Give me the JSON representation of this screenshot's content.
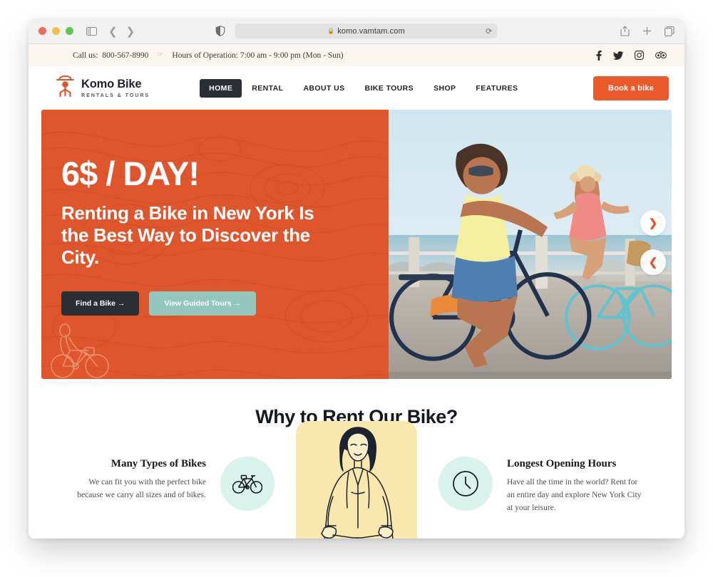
{
  "browser": {
    "url": "komo.vamtam.com",
    "lock_icon": "lock-icon",
    "reload_icon": "reload-icon",
    "back_icon": "chevron-left-icon",
    "forward_icon": "chevron-right-icon",
    "sidebar_icon": "sidebar-toggle-icon",
    "shield_icon": "privacy-shield-icon",
    "share_icon": "share-icon",
    "newtab_icon": "plus-icon",
    "tabs_icon": "tab-overview-icon"
  },
  "topbar": {
    "call_label": "Call us:",
    "phone": "800-567-8990",
    "separator_icon": "pointing-hand-icon",
    "hours": "Hours of Operation: 7:00 am - 9:00 pm (Mon - Sun)",
    "social": [
      {
        "name": "facebook-icon",
        "label": "f"
      },
      {
        "name": "twitter-icon",
        "label": ""
      },
      {
        "name": "instagram-icon",
        "label": ""
      },
      {
        "name": "tripadvisor-icon",
        "label": ""
      }
    ]
  },
  "header": {
    "logo_icon": "komo-bike-logo-icon",
    "logo_title": "Komo Bike",
    "logo_subtitle": "RENTALS & TOURS",
    "nav": [
      {
        "label": "HOME",
        "active": true
      },
      {
        "label": "RENTAL",
        "active": false
      },
      {
        "label": "ABOUT US",
        "active": false
      },
      {
        "label": "BIKE TOURS",
        "active": false
      },
      {
        "label": "SHOP",
        "active": false
      },
      {
        "label": "FEATURES",
        "active": false
      }
    ],
    "cta_label": "Book a bike"
  },
  "hero": {
    "price": "6$ / DAY!",
    "headline": "Renting a Bike in New York Is the Best Way to Discover the City.",
    "primary_button": "Find a Bike →",
    "secondary_button": "View Guided Tours →",
    "next_arrow": "❯",
    "prev_arrow": "❮",
    "cyclist_icon": "line-art-cyclist-icon",
    "photo_alt": "two-women-riding-bikes-photo"
  },
  "why": {
    "title": "Why to Rent Our Bike?",
    "features": [
      {
        "icon": "bicycle-icon",
        "title": "Many Types of Bikes",
        "desc": "We can fit you with the perfect bike because we carry all sizes and of bikes."
      },
      {
        "icon": "clock-icon",
        "title": "Longest Opening Hours",
        "desc": "Have all the time in the world? Rent for an entire day and explore New York City at your leisure."
      }
    ],
    "illustration": "woman-on-bike-illustration"
  },
  "colors": {
    "brand_orange": "#e0562c",
    "dark": "#2b2e35",
    "teal": "#93c6bd",
    "mint": "#d9f2ec",
    "yellow": "#f9e8ad",
    "topbar_bg": "#faf6ef"
  }
}
